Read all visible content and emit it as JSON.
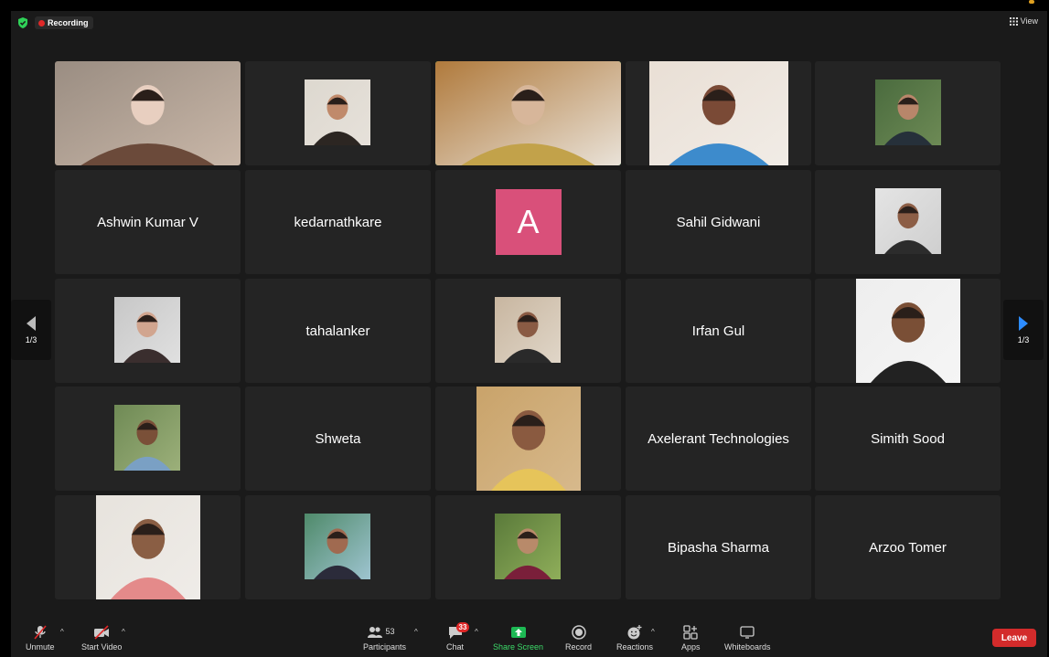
{
  "topbar": {
    "recording_label": "Recording",
    "view_label": "View"
  },
  "pager": {
    "left_label": "1/3",
    "right_label": "1/3"
  },
  "tiles": [
    {
      "kind": "video",
      "icon": "participant-video-woman-glasses"
    },
    {
      "kind": "photo",
      "icon": "participant-photo-man-beard"
    },
    {
      "kind": "video",
      "icon": "participant-video-woman-active-speaker",
      "active": true
    },
    {
      "kind": "video",
      "icon": "participant-video-woman"
    },
    {
      "kind": "photo",
      "icon": "participant-photo-man-sunglasses"
    },
    {
      "kind": "name",
      "name": "Ashwin Kumar V"
    },
    {
      "kind": "name",
      "name": "kedarnathkare"
    },
    {
      "kind": "avatar",
      "letter": "A",
      "color": "#d9507a"
    },
    {
      "kind": "name",
      "name": "Sahil Gidwani"
    },
    {
      "kind": "photo",
      "icon": "participant-photo-man-standing"
    },
    {
      "kind": "photo",
      "icon": "participant-photo-woman-hijab"
    },
    {
      "kind": "name",
      "name": "tahalanker"
    },
    {
      "kind": "photo",
      "icon": "participant-photo-man-glasses"
    },
    {
      "kind": "name",
      "name": "Irfan Gul"
    },
    {
      "kind": "photo",
      "icon": "participant-photo-man-smiling"
    },
    {
      "kind": "photo",
      "icon": "participant-photo-man-outdoor"
    },
    {
      "kind": "name",
      "name": "Shweta"
    },
    {
      "kind": "photo",
      "icon": "participant-photo-woman-smiling"
    },
    {
      "kind": "name",
      "name": "Axelerant Technologies"
    },
    {
      "kind": "name",
      "name": "Simith Sood"
    },
    {
      "kind": "photo",
      "icon": "participant-photo-man-pink-shirt"
    },
    {
      "kind": "photo",
      "icon": "participant-photo-man-turban"
    },
    {
      "kind": "photo",
      "icon": "participant-photo-man-maroon-shirt"
    },
    {
      "kind": "name",
      "name": "Bipasha Sharma"
    },
    {
      "kind": "name",
      "name": "Arzoo Tomer"
    }
  ],
  "toolbar": {
    "unmute_label": "Unmute",
    "start_video_label": "Start Video",
    "participants_label": "Participants",
    "participants_count": "53",
    "chat_label": "Chat",
    "chat_badge": "33",
    "share_label": "Share Screen",
    "record_label": "Record",
    "reactions_label": "Reactions",
    "apps_label": "Apps",
    "whiteboards_label": "Whiteboards",
    "leave_label": "Leave"
  },
  "colors": {
    "accent_green": "#2fd158",
    "share_green": "#1db954",
    "leave_red": "#d32b2b",
    "badge_red": "#e02828",
    "tile_bg": "#242424"
  }
}
